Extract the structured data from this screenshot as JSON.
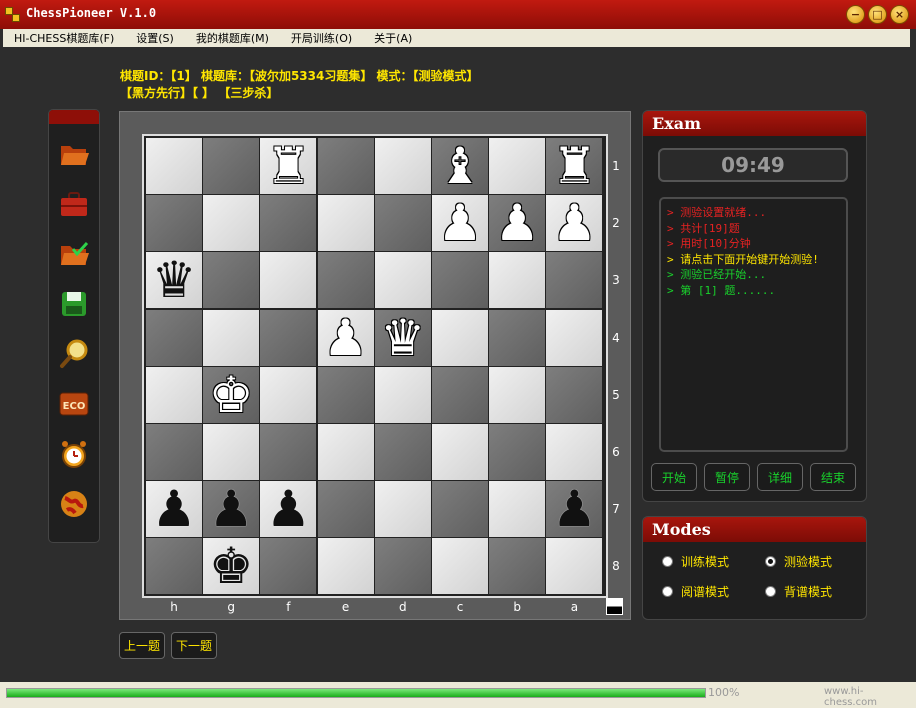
{
  "window": {
    "title": "ChessPioneer V.1.0",
    "min": "−",
    "max": "□",
    "close": "×"
  },
  "menu": [
    "HI-CHESS棋题库(F)",
    "设置(S)",
    "我的棋题库(M)",
    "开局训练(O)",
    "关于(A)"
  ],
  "info": {
    "line1": "棋题ID：【1】 棋题库：【波尔加5334习题集】 模式：【测验模式】",
    "line2": "【黑方先行】【 】 【三步杀】"
  },
  "toolbar_icons": [
    "folder-open-icon",
    "briefcase-icon",
    "folder-check-icon",
    "save-icon",
    "search-icon",
    "eco-icon",
    "alarm-clock-icon",
    "globe-icon"
  ],
  "board": {
    "files": [
      "h",
      "g",
      "f",
      "e",
      "d",
      "c",
      "b",
      "a"
    ],
    "ranks": [
      "1",
      "2",
      "3",
      "4",
      "5",
      "6",
      "7",
      "8"
    ],
    "squares": [
      [
        "",
        "",
        "wR",
        "",
        "",
        "wB",
        "",
        "wR"
      ],
      [
        "",
        "",
        "",
        "",
        "",
        "wP",
        "wP",
        "wP"
      ],
      [
        "bQ",
        "",
        "",
        "",
        "",
        "",
        "",
        ""
      ],
      [
        "",
        "",
        "",
        "wP",
        "wQ",
        "",
        "",
        ""
      ],
      [
        "",
        "wK",
        "",
        "",
        "",
        "",
        "",
        ""
      ],
      [
        "",
        "",
        "",
        "",
        "",
        "",
        "",
        ""
      ],
      [
        "bP",
        "bP",
        "bP",
        "",
        "",
        "",
        "",
        "bP"
      ],
      [
        "",
        "bK",
        "",
        "",
        "",
        "",
        "",
        ""
      ]
    ]
  },
  "nav": {
    "prev": "上一题",
    "next": "下一题"
  },
  "exam": {
    "title": "Exam",
    "timer": "09:49",
    "log": [
      {
        "text": "> 测验设置就绪...",
        "color": "#e62222"
      },
      {
        "text": "> 共计[19]题",
        "color": "#e62222"
      },
      {
        "text": "> 用时[10]分钟",
        "color": "#e62222"
      },
      {
        "text": "> 请点击下面开始键开始测验!",
        "color": "#ffe600"
      },
      {
        "text": "> 测验已经开始...",
        "color": "#19d22c"
      },
      {
        "text": "> 第 [1] 题......",
        "color": "#19d22c"
      }
    ],
    "buttons": [
      "开始",
      "暂停",
      "详细",
      "结束"
    ]
  },
  "modes": {
    "title": "Modes",
    "options": [
      {
        "label": "训练模式",
        "selected": false
      },
      {
        "label": "测验模式",
        "selected": true
      },
      {
        "label": "阅谱模式",
        "selected": false
      },
      {
        "label": "背谱模式",
        "selected": false
      }
    ]
  },
  "status": {
    "progress_pct": 100,
    "progress_text": "100%",
    "site": "www.hi-chess.com"
  }
}
